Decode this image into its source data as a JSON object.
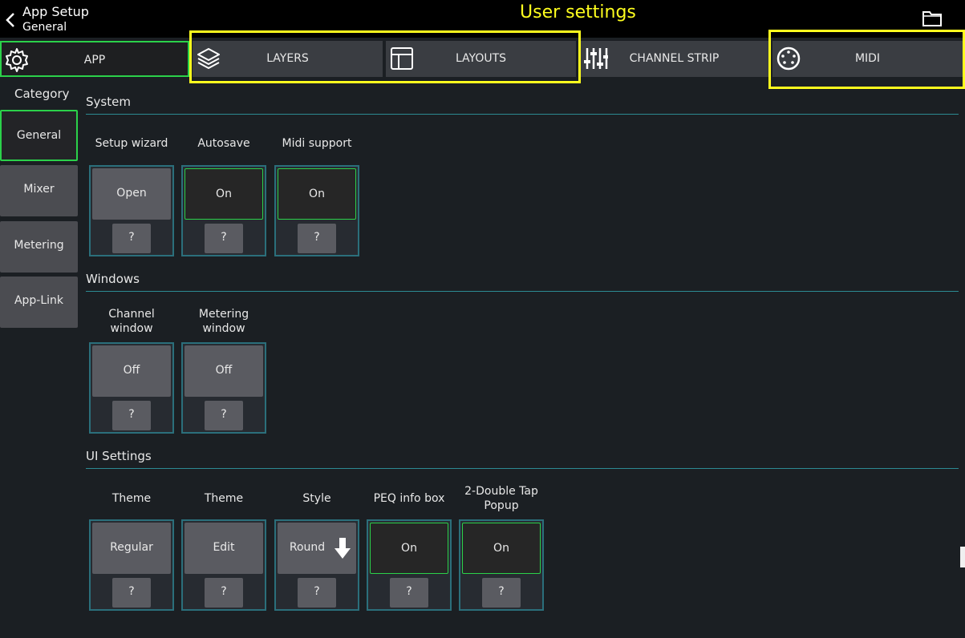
{
  "header": {
    "title": "App Setup",
    "subtitle": "General",
    "annotation": "User settings",
    "icons": [
      "back-chevron-icon",
      "folder-icon"
    ]
  },
  "tabs": [
    {
      "label": "APP",
      "icon": "gear-icon",
      "active": true
    },
    {
      "label": "LAYERS",
      "icon": "layers-icon",
      "active": false
    },
    {
      "label": "LAYOUTS",
      "icon": "layout-icon",
      "active": false
    },
    {
      "label": "CHANNEL STRIP",
      "icon": "sliders-icon",
      "active": false
    },
    {
      "label": "MIDI",
      "icon": "midi-connector-icon",
      "active": false
    }
  ],
  "sidebar": {
    "title": "Category",
    "items": [
      {
        "label": "General",
        "active": true
      },
      {
        "label": "Mixer",
        "active": false
      },
      {
        "label": "Metering",
        "active": false
      },
      {
        "label": "App-Link",
        "active": false
      }
    ]
  },
  "sections": {
    "system": {
      "title": "System",
      "items": [
        {
          "caption": "Setup wizard",
          "value": "Open",
          "help": "?"
        },
        {
          "caption": "Autosave",
          "value": "On",
          "help": "?"
        },
        {
          "caption": "Midi support",
          "value": "On",
          "help": "?"
        }
      ]
    },
    "windows": {
      "title": "Windows",
      "items": [
        {
          "caption": "Channel window",
          "value": "Off",
          "help": "?"
        },
        {
          "caption": "Metering window",
          "value": "Off",
          "help": "?"
        }
      ]
    },
    "ui": {
      "title": "UI Settings",
      "items": [
        {
          "caption": "Theme",
          "value": "Regular",
          "help": "?"
        },
        {
          "caption": "Theme",
          "value": "Edit",
          "help": "?"
        },
        {
          "caption": "Style",
          "value": "Round",
          "help": "?"
        },
        {
          "caption": "PEQ info box",
          "value": "On",
          "help": "?"
        },
        {
          "caption": "2-Double Tap Popup",
          "value": "On",
          "help": "?"
        }
      ]
    }
  },
  "colors": {
    "accent_green": "#2bd14a",
    "highlight_yellow": "#ffff1e",
    "section_line": "#2c8a92",
    "background": "#1b1f23"
  }
}
